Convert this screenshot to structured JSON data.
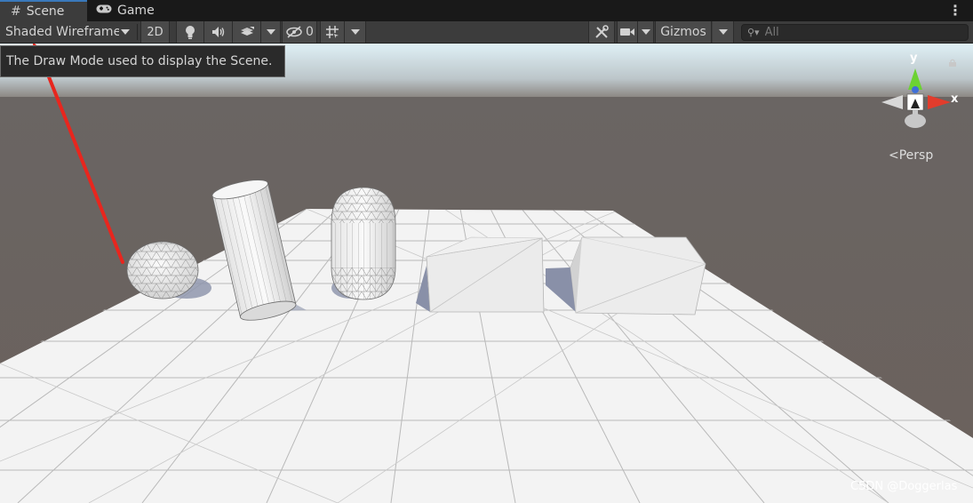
{
  "tabs": [
    {
      "label": "Scene",
      "icon": "grid-icon"
    },
    {
      "label": "Game",
      "icon": "gamepad-icon"
    }
  ],
  "toolbar": {
    "draw_mode": "Shaded Wireframe",
    "mode_2d": "2D",
    "hidden_count": "0",
    "gizmos": "Gizmos",
    "search_placeholder": "All"
  },
  "tooltip": "The Draw Mode used to display the Scene.",
  "gizmo": {
    "y_label": "y",
    "x_label": "x",
    "projection": "Persp"
  },
  "watermark": "CSDN @Doggerlas",
  "colors": {
    "sky_top": "#cfe4ee",
    "horizon": "#6a6663",
    "ground": "#6b625e",
    "plane": "#f2f2f2",
    "arrow": "#e8261e",
    "axis_y": "#6cd232",
    "axis_x": "#e23c2c",
    "axis_z": "#3f6fd6"
  }
}
